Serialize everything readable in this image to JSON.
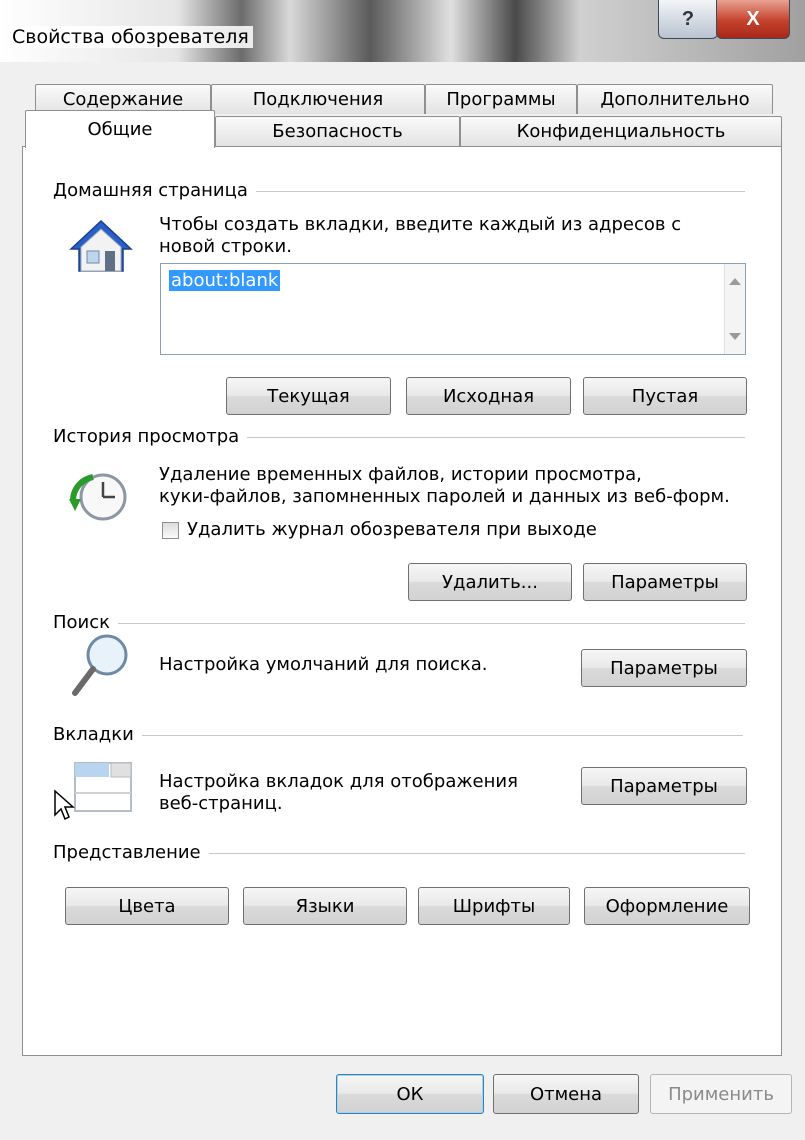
{
  "window": {
    "title": "Свойства обозревателя",
    "help_glyph": "?",
    "close_glyph": "X"
  },
  "tabs": {
    "top_row": [
      "Содержание",
      "Подключения",
      "Программы",
      "Дополнительно"
    ],
    "bottom_row": [
      "Общие",
      "Безопасность",
      "Конфиденциальность"
    ],
    "active": "Общие"
  },
  "home_page": {
    "label": "Домашняя страница",
    "instruction": "Чтобы создать вкладки, введите каждый из адресов с новой строки.",
    "instruction_line1": "Чтобы создать вкладки, введите каждый из адресов с",
    "instruction_line2": "новой строки.",
    "value": "about:blank",
    "buttons": {
      "current": "Текущая",
      "default": "Исходная",
      "blank": "Пустая"
    }
  },
  "history": {
    "label": "История просмотра",
    "line1": "Удаление временных файлов, истории просмотра,",
    "line2": "куки-файлов, запомненных паролей и данных из веб-форм.",
    "checkbox_label": "Удалить журнал обозревателя при выходе",
    "checkbox_checked": false,
    "buttons": {
      "delete": "Удалить...",
      "settings": "Параметры"
    }
  },
  "search": {
    "label": "Поиск",
    "description": "Настройка умолчаний для поиска.",
    "button": "Параметры"
  },
  "tabs_section": {
    "label": "Вкладки",
    "line1": "Настройка вкладок для отображения",
    "line2": "веб-страниц.",
    "button": "Параметры"
  },
  "appearance": {
    "label": "Представление",
    "buttons": {
      "colors": "Цвета",
      "languages": "Языки",
      "fonts": "Шрифты",
      "accessibility": "Оформление"
    }
  },
  "footer": {
    "ok": "ОК",
    "cancel": "Отмена",
    "apply": "Применить"
  },
  "colors": {
    "selection": "#3399ff",
    "close": "#c4422b"
  }
}
